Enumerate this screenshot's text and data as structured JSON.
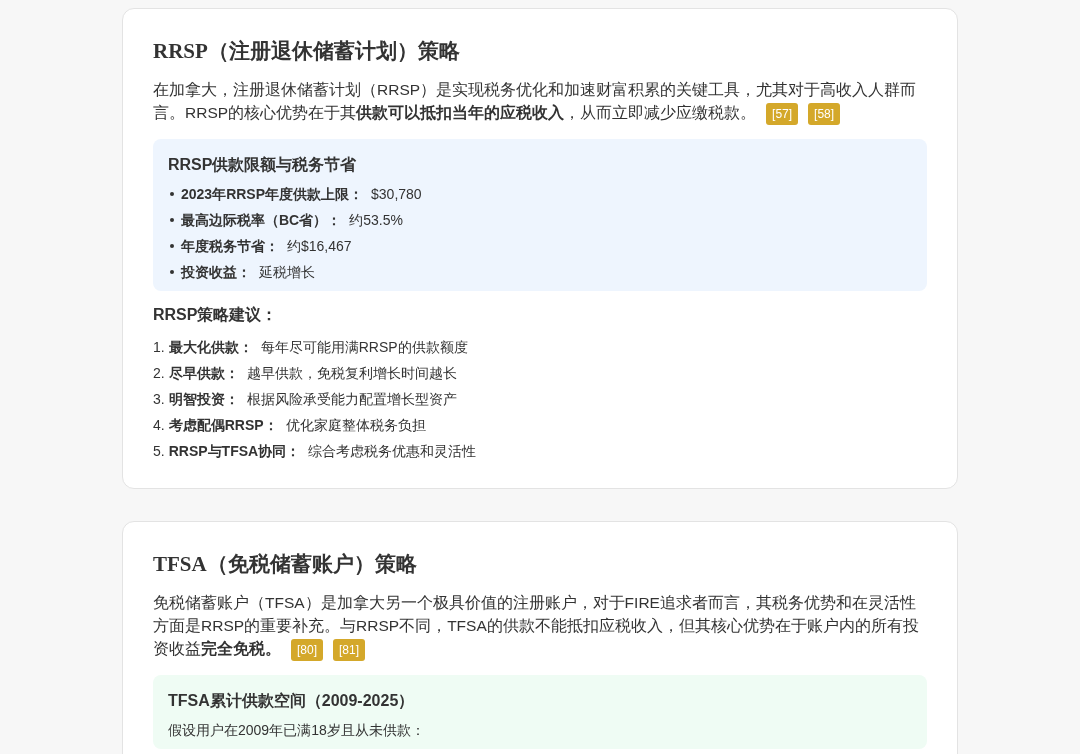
{
  "sections": [
    {
      "title": "RRSP（注册退休储蓄计划）策略",
      "paragraph": "在加拿大，注册退休储蓄计划（RRSP）是实现税务优化和加速财富积累的关键工具，尤其对于高收入人群而言。RRSP的核心优势在于其**供款可以抵扣当年的应税收入**，从而立即减少应缴税款。",
      "citations": [
        "[57]",
        "[58]"
      ],
      "info_box": {
        "kind": "blue",
        "title": "RRSP供款限额与税务节省",
        "items": [
          {
            "label": "2023年RRSP年度供款上限：",
            "value": "$30,780"
          },
          {
            "label": "最高边际税率（BC省）：",
            "value": "约53.5%"
          },
          {
            "label": "年度税务节省：",
            "value": "约$16,467"
          },
          {
            "label": "投资收益：",
            "value": "延税增长"
          }
        ]
      },
      "list_title": "RRSP策略建议：",
      "steps": [
        {
          "number": "1.",
          "label": "最大化供款：",
          "value": "每年尽可能用满RRSP的供款额度"
        },
        {
          "number": "2.",
          "label": "尽早供款：",
          "value": "越早供款，免税复利增长时间越长"
        },
        {
          "number": "3.",
          "label": "明智投资：",
          "value": "根据风险承受能力配置增长型资产"
        },
        {
          "number": "4.",
          "label": "考虑配偶RRSP：",
          "value": "优化家庭整体税务负担"
        },
        {
          "number": "5.",
          "label": "RRSP与TFSA协同：",
          "value": "综合考虑税务优惠和灵活性"
        }
      ]
    },
    {
      "title": "TFSA（免税储蓄账户）策略",
      "paragraph": "免税储蓄账户（TFSA）是加拿大另一个极具价值的注册账户，对于FIRE追求者而言，其税务优势和在灵活性方面是RRSP的重要补充。与RRSP不同，TFSA的供款不能抵扣应税收入，但其核心优势在于账户内的所有投资收益**完全免税。**",
      "citations": [
        "[80]",
        "[81]"
      ],
      "info_box": {
        "kind": "green",
        "title": "TFSA累计供款空间（2009-2025）",
        "note": "假设用户在2009年已满18岁且从未供款："
      }
    }
  ]
}
